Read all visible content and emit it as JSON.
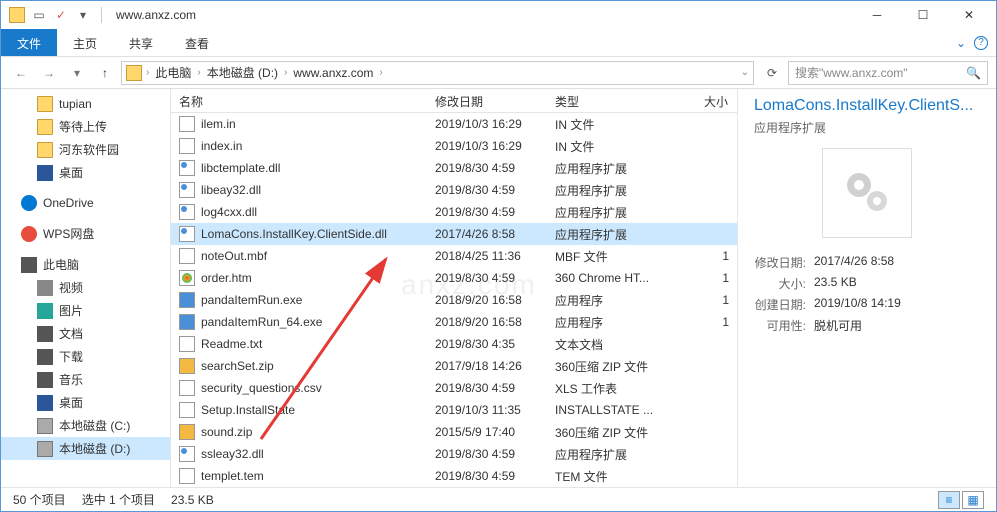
{
  "window": {
    "title": "www.anxz.com"
  },
  "ribbon": {
    "file": "文件",
    "home": "主页",
    "share": "共享",
    "view": "查看"
  },
  "breadcrumb": {
    "items": [
      "此电脑",
      "本地磁盘 (D:)",
      "www.anxz.com"
    ]
  },
  "search": {
    "placeholder": "搜索\"www.anxz.com\""
  },
  "tree": {
    "items": [
      {
        "label": "tupian",
        "icon": "folder",
        "indent": true
      },
      {
        "label": "等待上传",
        "icon": "folder",
        "indent": true
      },
      {
        "label": "河东软件园",
        "icon": "folder",
        "indent": true
      },
      {
        "label": "桌面",
        "icon": "desktop",
        "indent": true
      },
      {
        "label": "",
        "spacer": true
      },
      {
        "label": "OneDrive",
        "icon": "onedrive"
      },
      {
        "label": "",
        "spacer": true
      },
      {
        "label": "WPS网盘",
        "icon": "wps"
      },
      {
        "label": "",
        "spacer": true
      },
      {
        "label": "此电脑",
        "icon": "pc"
      },
      {
        "label": "视频",
        "icon": "video",
        "indent": true
      },
      {
        "label": "图片",
        "icon": "pictures",
        "indent": true
      },
      {
        "label": "文档",
        "icon": "docs",
        "indent": true
      },
      {
        "label": "下载",
        "icon": "download",
        "indent": true
      },
      {
        "label": "音乐",
        "icon": "music",
        "indent": true
      },
      {
        "label": "桌面",
        "icon": "desktop",
        "indent": true
      },
      {
        "label": "本地磁盘 (C:)",
        "icon": "drive",
        "indent": true
      },
      {
        "label": "本地磁盘 (D:)",
        "icon": "drive",
        "indent": true,
        "selected": true
      }
    ]
  },
  "columns": {
    "name": "名称",
    "date": "修改日期",
    "type": "类型",
    "size": "大小"
  },
  "files": [
    {
      "name": "ilem.in",
      "date": "2019/10/3 16:29",
      "type": "IN 文件",
      "size": "",
      "icon": "file"
    },
    {
      "name": "index.in",
      "date": "2019/10/3 16:29",
      "type": "IN 文件",
      "size": "",
      "icon": "file"
    },
    {
      "name": "libctemplate.dll",
      "date": "2019/8/30 4:59",
      "type": "应用程序扩展",
      "size": "",
      "icon": "dll"
    },
    {
      "name": "libeay32.dll",
      "date": "2019/8/30 4:59",
      "type": "应用程序扩展",
      "size": "",
      "icon": "dll"
    },
    {
      "name": "log4cxx.dll",
      "date": "2019/8/30 4:59",
      "type": "应用程序扩展",
      "size": "",
      "icon": "dll"
    },
    {
      "name": "LomaCons.InstallKey.ClientSide.dll",
      "date": "2017/4/26 8:58",
      "type": "应用程序扩展",
      "size": "",
      "icon": "dll",
      "selected": true
    },
    {
      "name": "noteOut.mbf",
      "date": "2018/4/25 11:36",
      "type": "MBF 文件",
      "size": "1",
      "icon": "file"
    },
    {
      "name": "order.htm",
      "date": "2019/8/30 4:59",
      "type": "360 Chrome HT...",
      "size": "1",
      "icon": "htm"
    },
    {
      "name": "pandaItemRun.exe",
      "date": "2018/9/20 16:58",
      "type": "应用程序",
      "size": "1",
      "icon": "exe"
    },
    {
      "name": "pandaItemRun_64.exe",
      "date": "2018/9/20 16:58",
      "type": "应用程序",
      "size": "1",
      "icon": "exe"
    },
    {
      "name": "Readme.txt",
      "date": "2019/8/30 4:35",
      "type": "文本文档",
      "size": "",
      "icon": "file"
    },
    {
      "name": "searchSet.zip",
      "date": "2017/9/18 14:26",
      "type": "360压缩 ZIP 文件",
      "size": "",
      "icon": "zip"
    },
    {
      "name": "security_questions.csv",
      "date": "2019/8/30 4:59",
      "type": "XLS 工作表",
      "size": "",
      "icon": "file"
    },
    {
      "name": "Setup.InstallState",
      "date": "2019/10/3 11:35",
      "type": "INSTALLSTATE ...",
      "size": "",
      "icon": "file"
    },
    {
      "name": "sound.zip",
      "date": "2015/5/9 17:40",
      "type": "360压缩 ZIP 文件",
      "size": "",
      "icon": "zip"
    },
    {
      "name": "ssleay32.dll",
      "date": "2019/8/30 4:59",
      "type": "应用程序扩展",
      "size": "",
      "icon": "dll"
    },
    {
      "name": "templet.tem",
      "date": "2019/8/30 4:59",
      "type": "TEM 文件",
      "size": "",
      "icon": "file"
    }
  ],
  "details": {
    "title": "LomaCons.InstallKey.ClientS...",
    "subtitle": "应用程序扩展",
    "rows": [
      {
        "label": "修改日期:",
        "value": "2017/4/26 8:58"
      },
      {
        "label": "大小:",
        "value": "23.5 KB"
      },
      {
        "label": "创建日期:",
        "value": "2019/10/8 14:19"
      },
      {
        "label": "可用性:",
        "value": "脱机可用"
      }
    ]
  },
  "status": {
    "count": "50 个项目",
    "selection": "选中 1 个项目",
    "size": "23.5 KB"
  },
  "watermark": "anxz.com"
}
